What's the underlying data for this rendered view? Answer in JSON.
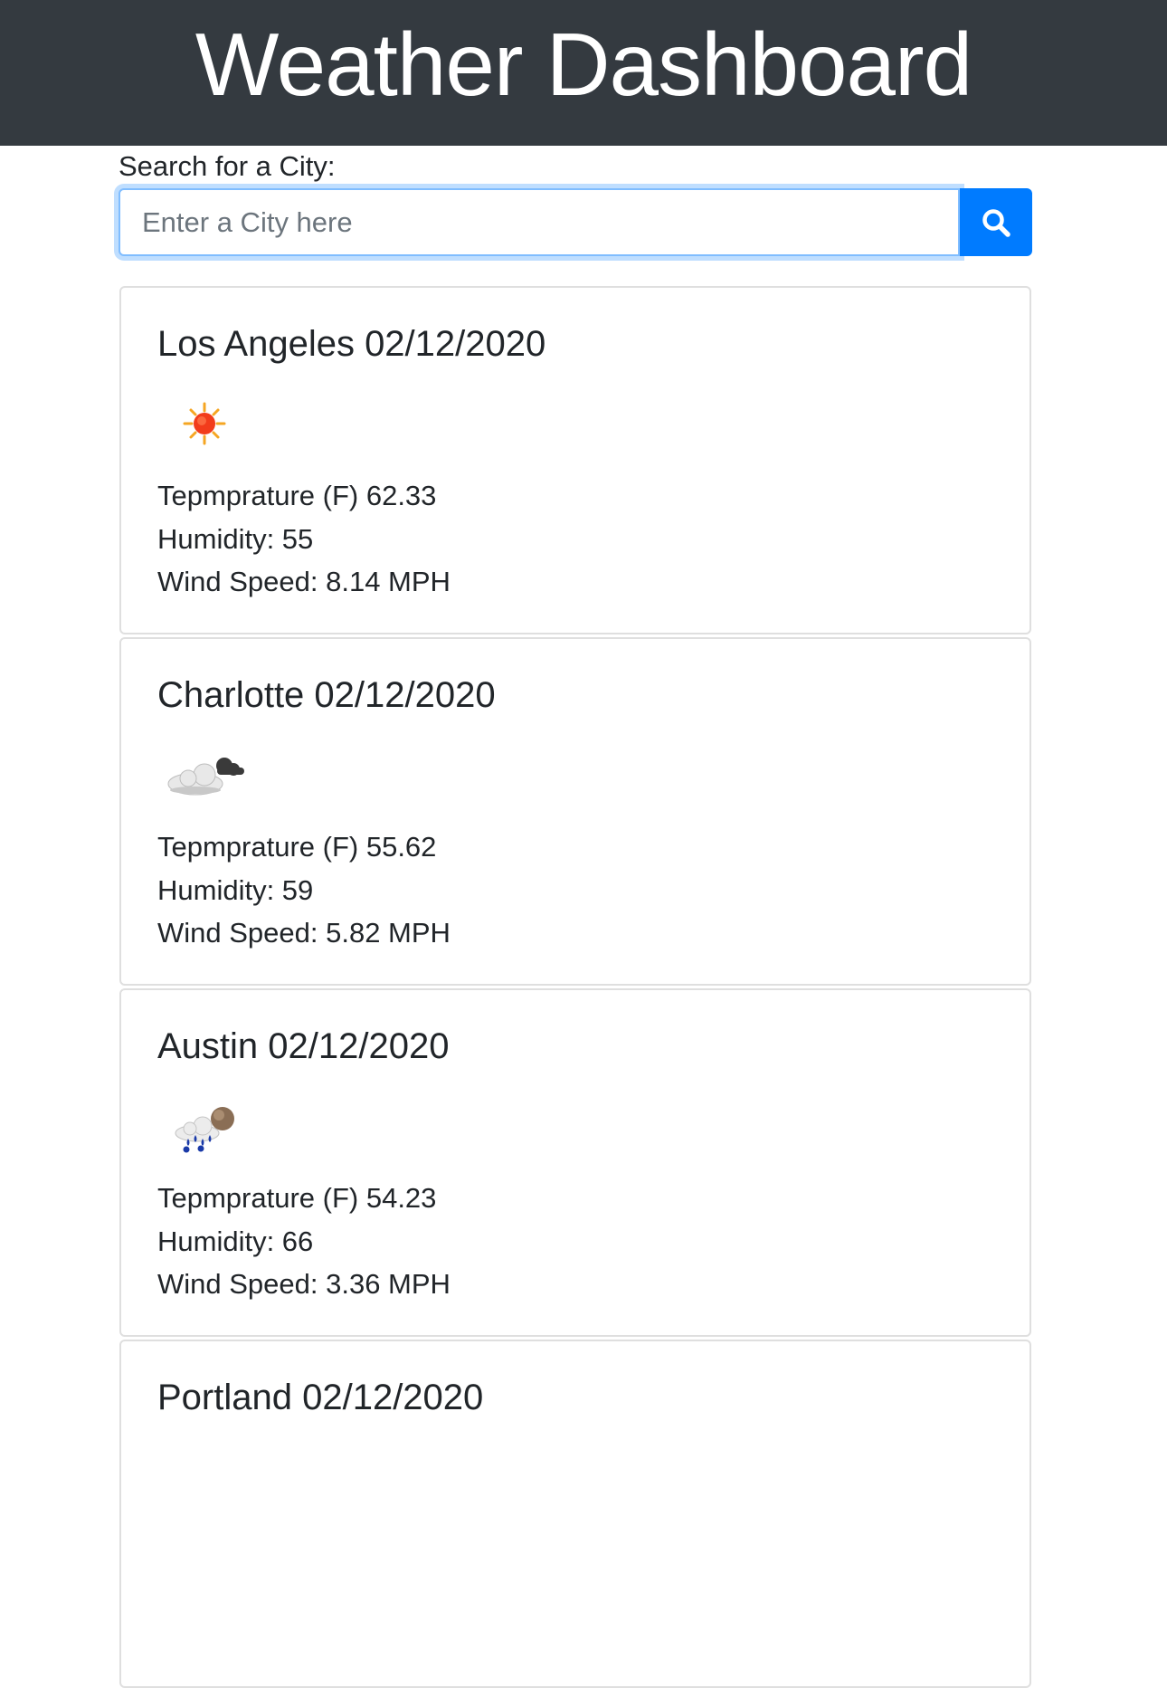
{
  "header": {
    "title": "Weather Dashboard"
  },
  "search": {
    "label": "Search for a City:",
    "placeholder": "Enter a City here",
    "value": "",
    "button_icon": "search-icon"
  },
  "colors": {
    "header_bg": "#343a40",
    "accent": "#007bff",
    "card_border": "#dfdfdf"
  },
  "cards": [
    {
      "title": "Los Angeles 02/12/2020",
      "icon": "sun-icon",
      "temperature": "Tepmprature (F) 62.33",
      "humidity": "Humidity: 55",
      "wind": "Wind Speed: 8.14 MPH"
    },
    {
      "title": "Charlotte 02/12/2020",
      "icon": "cloudy-icon",
      "temperature": "Tepmprature (F) 55.62",
      "humidity": "Humidity: 59",
      "wind": "Wind Speed: 5.82 MPH"
    },
    {
      "title": "Austin 02/12/2020",
      "icon": "rain-icon",
      "temperature": "Tepmprature (F) 54.23",
      "humidity": "Humidity: 66",
      "wind": "Wind Speed: 3.36 MPH"
    },
    {
      "title": "Portland 02/12/2020"
    }
  ]
}
